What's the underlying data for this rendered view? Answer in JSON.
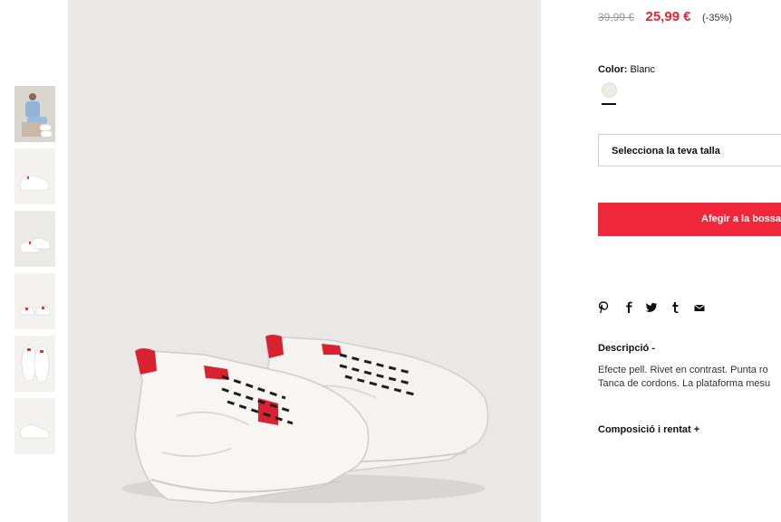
{
  "product": {
    "old_price": "39,99 €",
    "new_price": "25,99 €",
    "discount": "(-35%)",
    "color_label": "Color:",
    "color_value": "Blanc",
    "size_placeholder": "Selecciona la teva talla",
    "add_to_bag": "Afegir a la bossa",
    "description_title": "Descripció  -",
    "description_line1": "Efecte pell. Rivet en contrast. Punta ro",
    "description_line2": "Tanca de cordons. La plataforma mesu",
    "composition_title": "Composició i rentat  +"
  },
  "share_icons": [
    "pinterest-icon",
    "facebook-icon",
    "twitter-icon",
    "tumblr-icon",
    "mail-icon"
  ],
  "colors": {
    "accent": "#f0263b",
    "price_red": "#e52531",
    "swatch": "#ecebe4",
    "image_bg": "#e9e8e6"
  }
}
